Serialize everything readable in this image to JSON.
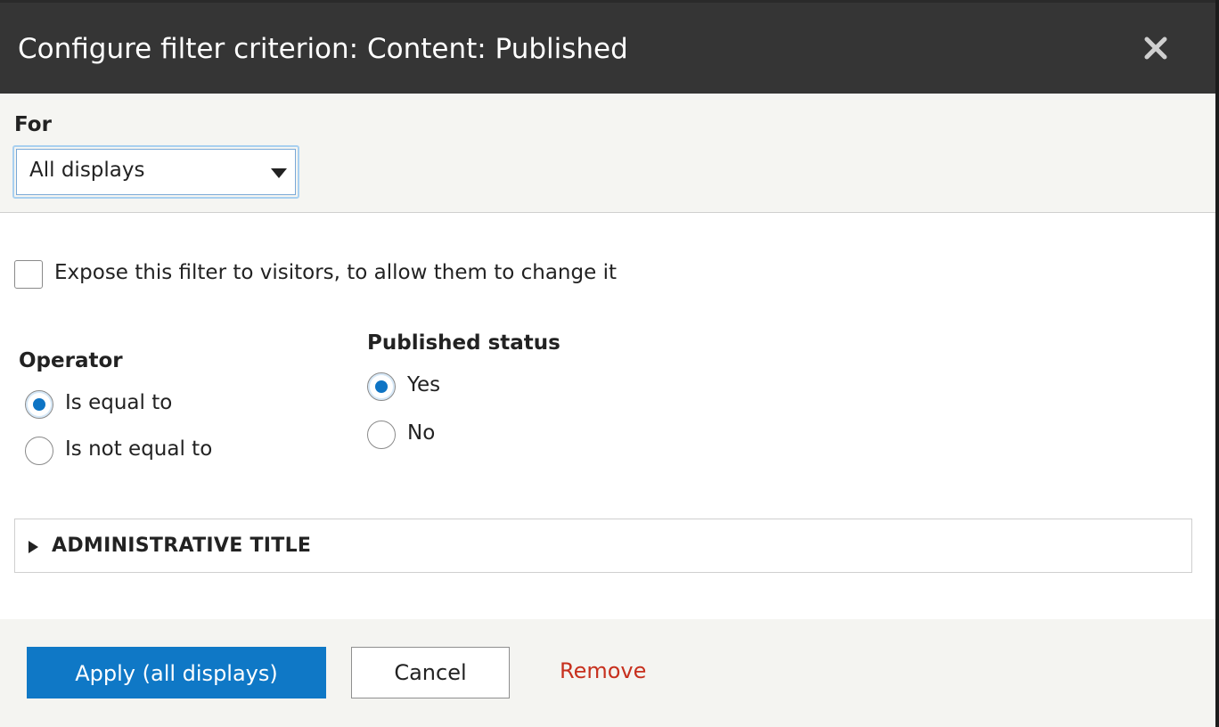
{
  "dialog": {
    "title": "Configure filter criterion: Content: Published",
    "close_icon": "close-icon"
  },
  "for_section": {
    "label": "For",
    "select_value": "All displays"
  },
  "expose": {
    "label": "Expose this filter to visitors, to allow them to change it",
    "checked": false
  },
  "operator": {
    "heading": "Operator",
    "options": [
      {
        "label": "Is equal to",
        "checked": true
      },
      {
        "label": "Is not equal to",
        "checked": false
      }
    ]
  },
  "published_status": {
    "heading": "Published status",
    "options": [
      {
        "label": "Yes",
        "checked": true
      },
      {
        "label": "No",
        "checked": false
      }
    ]
  },
  "administrative_title": {
    "summary": "ADMINISTRATIVE TITLE"
  },
  "footer": {
    "apply_label": "Apply (all displays)",
    "cancel_label": "Cancel",
    "remove_label": "Remove"
  },
  "colors": {
    "title_bar": "#353535",
    "primary_button": "#0f78c6",
    "radio_selected": "#0e74c4",
    "remove_link": "#c7301e"
  }
}
